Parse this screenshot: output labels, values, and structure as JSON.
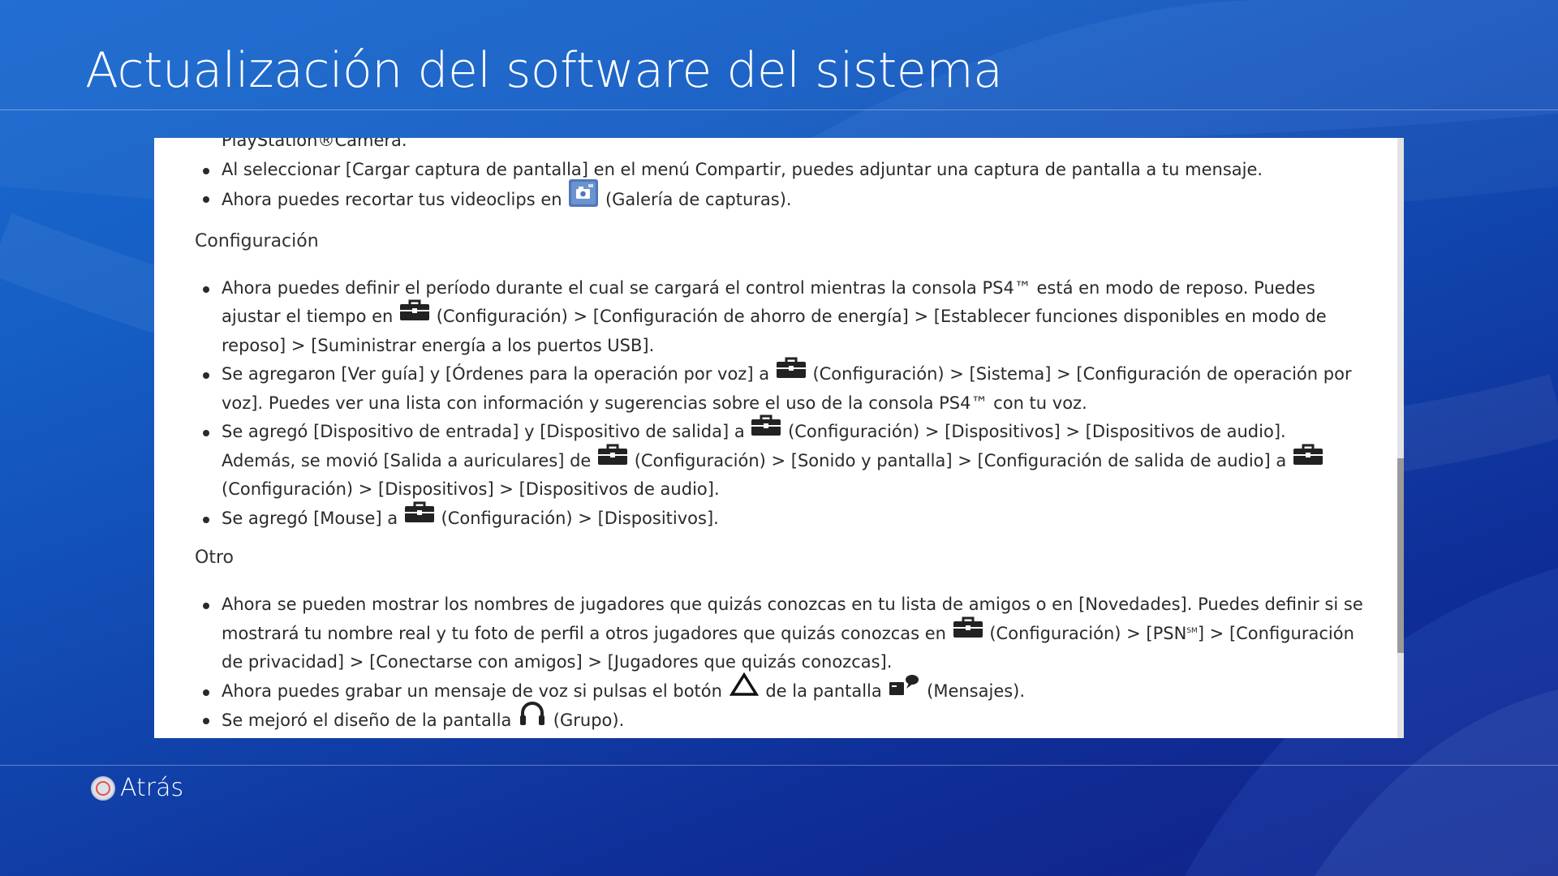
{
  "page": {
    "title": "Actualización del software del sistema",
    "back_label": "Atrás"
  },
  "content": {
    "top_items": [
      {
        "text": "PlayStation®Camera."
      },
      {
        "text": "Al seleccionar [Cargar captura de pantalla] en el menú Compartir, puedes adjuntar una captura de pantalla a tu mensaje."
      },
      {
        "before": "Ahora puedes recortar tus videoclips en",
        "after": "(Galería de capturas).",
        "icon": "capture-gallery-icon"
      }
    ],
    "configuracion": {
      "heading": "Configuración",
      "items": [
        {
          "p1": "Ahora puedes definir el período durante el cual se cargará el control mientras la consola PS4™ está en modo de reposo. Puedes ajustar el tiempo en",
          "p2": "(Configuración) > [Configuración de ahorro de energía] > [Establecer funciones disponibles en modo de reposo] > [Suministrar energía a los puertos USB]."
        },
        {
          "p1": "Se agregaron [Ver guía] y [Órdenes para la operación por voz] a",
          "p2": "(Configuración) > [Sistema] > [Configuración de operación por voz]. Puedes ver una lista con información y sugerencias sobre el uso de la consola PS4™ con tu voz."
        },
        {
          "p1": "Se agregó [Dispositivo de entrada] y [Dispositivo de salida] a",
          "p2": "(Configuración) > [Dispositivos] > [Dispositivos de audio]. Además, se movió [Salida a auriculares] de",
          "p3": "(Configuración) > [Sonido y pantalla] > [Configuración de salida de audio] a",
          "p4": "(Configuración) > [Dispositivos] > [Dispositivos de audio]."
        },
        {
          "p1": "Se agregó [Mouse] a",
          "p2": "(Configuración) > [Dispositivos]."
        }
      ]
    },
    "otro": {
      "heading": "Otro",
      "items": [
        {
          "p1": "Ahora se pueden mostrar los nombres de jugadores que quizás conozcas en tu lista de amigos o en [Novedades]. Puedes definir si se mostrará tu nombre real y tu foto de perfil a otros jugadores que quizás conozcas en",
          "p2": "(Configuración) > [PSN",
          "sup": "SM",
          "p3": "] > [Configuración de privacidad] > [Conectarse con amigos] > [Jugadores que quizás conozcas]."
        },
        {
          "p1": "Ahora puedes grabar un mensaje de voz si pulsas el botón",
          "p2": "de la pantalla",
          "p3": "(Mensajes)."
        },
        {
          "p1": "Se mejoró el diseño de la pantalla",
          "p2": "(Grupo)."
        }
      ]
    }
  },
  "icons": {
    "settings": "toolbox-icon",
    "capture_gallery": "capture-gallery-icon",
    "triangle_button": "triangle-button-icon",
    "messages": "messages-icon",
    "party": "headset-icon",
    "back_button": "circle-button-icon"
  },
  "colors": {
    "background_top": "#1a6ad0",
    "background_bottom": "#121f86",
    "panel": "#ffffff",
    "text": "#2a2a2a",
    "circle_button": "#e5534b"
  }
}
